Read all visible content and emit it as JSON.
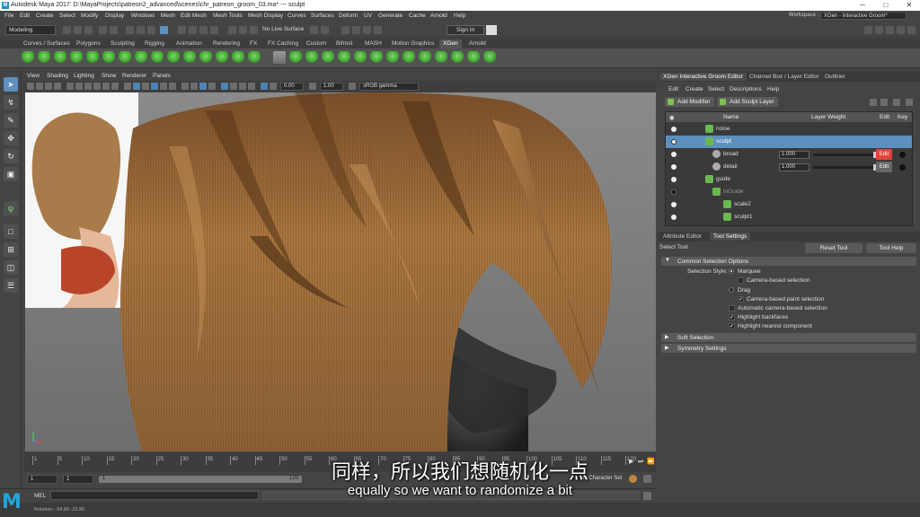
{
  "window": {
    "title": "Autodesk Maya 2017: D:\\MayaProjects\\patreon2_advanced\\scenes\\chr_patreon_groom_03.ma*   ---   sculpt",
    "app_icon": "maya-app-icon",
    "buttons": [
      "─",
      "□",
      "✕"
    ]
  },
  "menubar": {
    "items": [
      "File",
      "Edit",
      "Create",
      "Select",
      "Modify",
      "Display",
      "Windows",
      "Mesh",
      "Edit Mesh",
      "Mesh Tools",
      "Mesh Display",
      "Curves",
      "Surfaces",
      "Deform",
      "UV",
      "Generate",
      "Cache",
      "Arnold",
      "Help"
    ],
    "workspace_label": "Workspace :",
    "workspace_value": "XGen - Interactive Groom*"
  },
  "statusline": {
    "mode": "Modeling",
    "live_surface": "No Live Surface",
    "sign_in": "Sign In"
  },
  "shelf_tabs": {
    "items": [
      "Curves / Surfaces",
      "Polygons",
      "Sculpting",
      "Rigging",
      "Animation",
      "Rendering",
      "FX",
      "FX Caching",
      "Custom",
      "Bifrost",
      "MASH",
      "Motion Graphics",
      "XGen",
      "Arnold"
    ],
    "active": "XGen"
  },
  "viewport": {
    "menu": [
      "View",
      "Shading",
      "Lighting",
      "Show",
      "Renderer",
      "Panels"
    ],
    "exposure": "0.00",
    "gamma": "1.00",
    "color_space": "sRGB gamma"
  },
  "timeline": {
    "ticks": [
      "1",
      "5",
      "10",
      "15",
      "20",
      "25",
      "30",
      "35",
      "40",
      "45",
      "50",
      "55",
      "60",
      "65",
      "70",
      "75",
      "80",
      "85",
      "90",
      "95",
      "100",
      "105",
      "110",
      "115",
      "120"
    ],
    "current_frame": "1"
  },
  "range": {
    "start": "1",
    "inner_start": "1",
    "slider_start": "1",
    "slider_end": "120",
    "character_set": "No Character Set"
  },
  "commandline": {
    "label": "MEL"
  },
  "helpline": {
    "text": "Rotation:   -54.80     -22.80"
  },
  "right_panel": {
    "tabs": [
      "XGen Interactive Groom Editor",
      "Channel Box / Layer Editor",
      "Outliner"
    ],
    "active_tab": "XGen Interactive Groom Editor",
    "menu": [
      "Edit",
      "Create",
      "Select",
      "Descriptions",
      "Help"
    ],
    "add_modifier": "Add Modifier",
    "add_sculpt_layer": "Add Sculpt Layer",
    "groom_columns": [
      "Name",
      "Layer Weight",
      "Edit",
      "Key"
    ],
    "groom_rows": [
      {
        "name": "noise",
        "weight": "",
        "edit": ""
      },
      {
        "name": "sculpt",
        "weight": "",
        "edit": ""
      },
      {
        "name": "broad",
        "weight": "1.000",
        "edit": "Edit"
      },
      {
        "name": "detail",
        "weight": "1.000",
        "edit": "Edit"
      },
      {
        "name": "guide",
        "weight": "",
        "edit": ""
      },
      {
        "name": "inGuide",
        "weight": "",
        "edit": ""
      },
      {
        "name": "scale2",
        "weight": "",
        "edit": ""
      },
      {
        "name": "sculpt1",
        "weight": "",
        "edit": ""
      }
    ]
  },
  "attribute_panel": {
    "tabs": [
      "Attribute Editor",
      "Tool Settings"
    ],
    "active_tab": "Tool Settings",
    "tool_name": "Select Tool",
    "reset_tool": "Reset Tool",
    "tool_help": "Tool Help",
    "sections": [
      "Common Selection Options",
      "Soft Selection",
      "Symmetry Settings"
    ],
    "selection_style_label": "Selection Style:",
    "options": {
      "marquee": "Marquee",
      "camera_based_selection": "Camera-based selection",
      "drag": "Drag",
      "camera_based_paint_selection": "Camera-based paint selection",
      "automatic_camera_based_selection": "Automatic camera-based selection",
      "highlight_backfaces": "Highlight backfaces",
      "highlight_nearest_component": "Highlight nearest component"
    }
  },
  "subtitles": {
    "chinese": "同样，所以我们想随机化一点",
    "english": "equally so we want to randomize a bit"
  },
  "colors": {
    "accent_blue": "#5d8fbf",
    "edit_red": "#e0443a",
    "xgen_green": "#69b94f",
    "hair_brown": "#9a6a3c"
  }
}
